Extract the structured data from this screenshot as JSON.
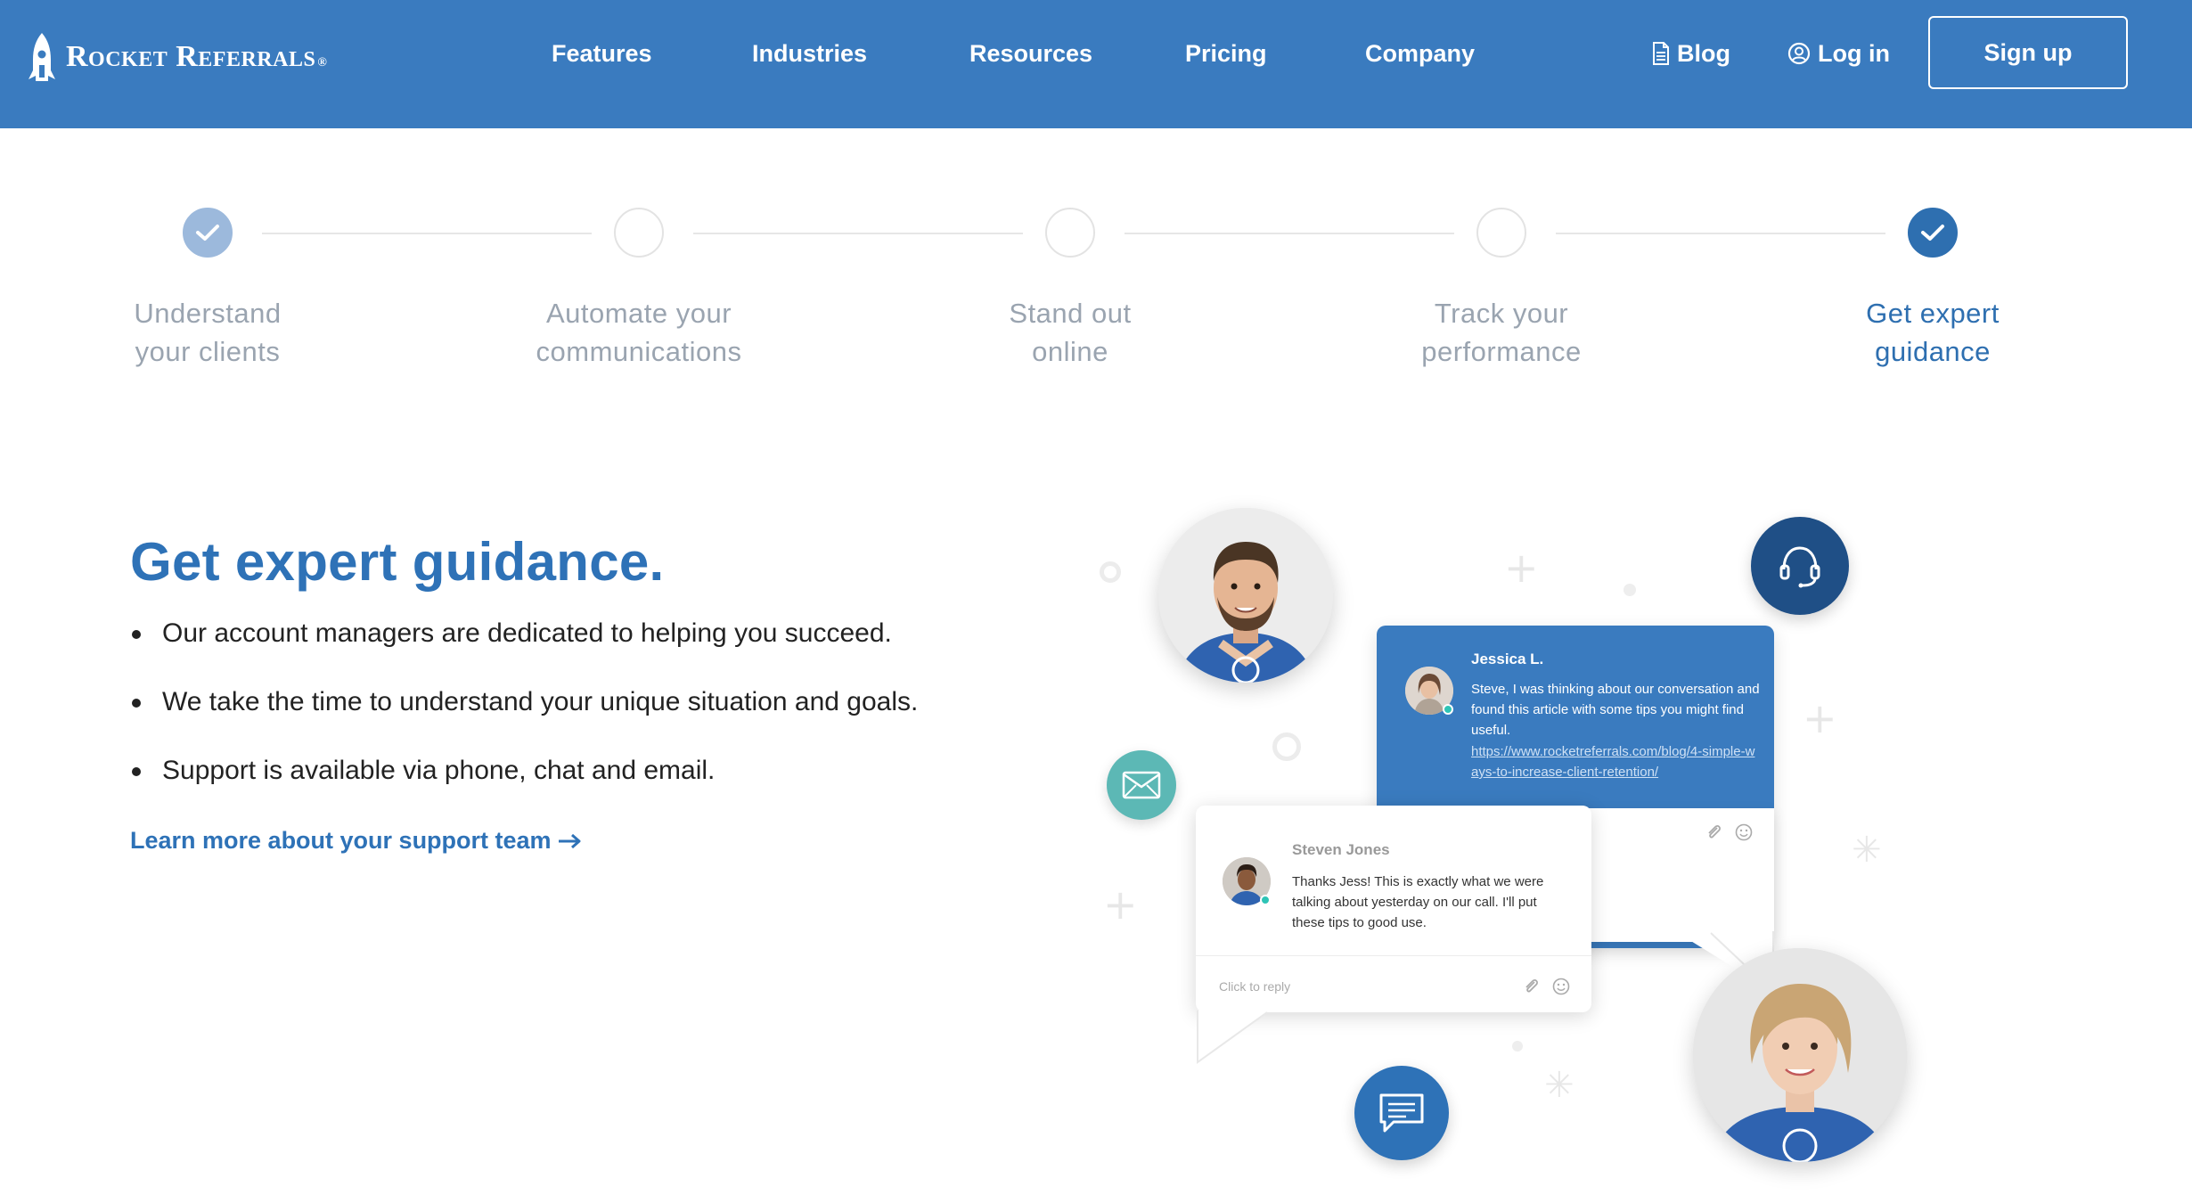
{
  "brand": {
    "name": "Rocket Referrals",
    "registered": "®",
    "primary_color": "#3a7bbf",
    "accent_color": "#2e72b7"
  },
  "nav": {
    "items": [
      {
        "label": "Features"
      },
      {
        "label": "Industries"
      },
      {
        "label": "Resources"
      },
      {
        "label": "Pricing"
      },
      {
        "label": "Company"
      }
    ],
    "blog": {
      "label": "Blog",
      "icon": "document-icon"
    },
    "login": {
      "label": "Log in",
      "icon": "user-circle-icon"
    },
    "signup": {
      "label": "Sign up"
    }
  },
  "stepper": {
    "steps": [
      {
        "line1": "Understand",
        "line2": "your clients",
        "state": "complete"
      },
      {
        "line1": "Automate your",
        "line2": "communications",
        "state": "incomplete"
      },
      {
        "line1": "Stand out",
        "line2": "online",
        "state": "incomplete"
      },
      {
        "line1": "Track your",
        "line2": "performance",
        "state": "incomplete"
      },
      {
        "line1": "Get expert",
        "line2": "guidance",
        "state": "active"
      }
    ]
  },
  "main": {
    "heading": "Get expert guidance.",
    "bullets": [
      "Our account managers are dedicated to helping you succeed.",
      "We take the time to understand your unique situation and goals.",
      "Support is available via phone, chat and email."
    ],
    "learn_more": {
      "label": "Learn more about your support team",
      "icon": "arrow-right-icon"
    }
  },
  "chat": {
    "message_1": {
      "sender": "Jessica L.",
      "text": "Steve, I was thinking about our conversation and found this article with some tips you might find useful.",
      "link": "https://www.rocketreferrals.com/blog/4-simple-ways-to-increase-client-retention/"
    },
    "message_2": {
      "sender": "Steven Jones",
      "text": "Thanks Jess! This is exactly what we were talking about yesterday on our call. I'll put these tips to good use.",
      "reply_placeholder": "Click to reply"
    }
  }
}
